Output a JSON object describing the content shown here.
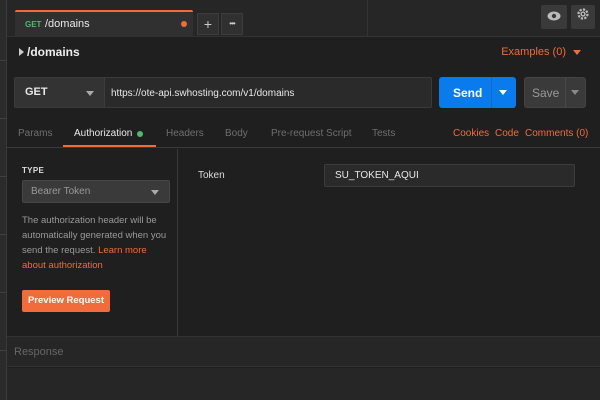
{
  "tab": {
    "method": "GET",
    "title": "/domains"
  },
  "tabbar": {
    "add_label": "+",
    "more_label": "•••",
    "eye_icon": "eye-icon",
    "gear_icon": "gear-icon"
  },
  "request": {
    "name": "/domains",
    "examples_label": "Examples (0)"
  },
  "urlbar": {
    "method": "GET",
    "url": "https://ote-api.swhosting.com/v1/domains"
  },
  "actions": {
    "send_label": "Send",
    "save_label": "Save"
  },
  "subtabs": {
    "params": "Params",
    "authorization": "Authorization",
    "headers": "Headers",
    "body": "Body",
    "prerequest": "Pre-request Script",
    "tests": "Tests",
    "cookies": "Cookies",
    "code": "Code",
    "comments": "Comments (0)"
  },
  "auth": {
    "type_label": "TYPE",
    "type_value": "Bearer Token",
    "desc_text": "The authorization header will be automatically generated when you send the request. ",
    "desc_link": "Learn more about authorization",
    "preview_label": "Preview Request",
    "token_label": "Token",
    "token_value": "SU_TOKEN_AQUI"
  },
  "response": {
    "label": "Response"
  },
  "colors": {
    "accent": "#f26b3a",
    "primary": "#097bed",
    "success": "#4cbb6c",
    "background": "#1f1f1f"
  }
}
